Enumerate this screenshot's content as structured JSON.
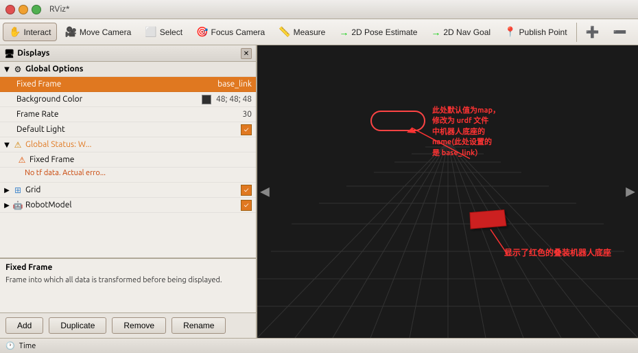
{
  "window": {
    "title": "RViz*"
  },
  "toolbar": {
    "interact_label": "Interact",
    "move_camera_label": "Move Camera",
    "select_label": "Select",
    "focus_camera_label": "Focus Camera",
    "measure_label": "Measure",
    "pose_estimate_label": "2D Pose Estimate",
    "nav_goal_label": "2D Nav Goal",
    "publish_point_label": "Publish Point"
  },
  "displays": {
    "title": "Displays",
    "global_options_label": "Global Options",
    "fixed_frame_label": "Fixed Frame",
    "fixed_frame_value": "base_link",
    "background_color_label": "Background Color",
    "background_color_value": "48; 48; 48",
    "frame_rate_label": "Frame Rate",
    "frame_rate_value": "30",
    "default_light_label": "Default Light",
    "global_status_label": "Global Status: W...",
    "fixed_frame_sub_label": "Fixed Frame",
    "fixed_frame_error": "No tf data.  Actual erro...",
    "grid_label": "Grid",
    "robot_model_label": "RobotModel"
  },
  "info_panel": {
    "title": "Fixed Frame",
    "description": "Frame into which all data is transformed before\nbeing displayed."
  },
  "buttons": {
    "add": "Add",
    "duplicate": "Duplicate",
    "remove": "Remove",
    "rename": "Rename"
  },
  "annotations": {
    "annotation1": "此处默认值为map，",
    "annotation2": "修改为 urdf 文件",
    "annotation3": "中机器人底座的",
    "annotation4": "name(此处设置的",
    "annotation5": "是 base_link）",
    "annotation6": "显示了红色的叠装机器人底座"
  },
  "statusbar": {
    "time_label": "Time"
  },
  "colors": {
    "accent_orange": "#e07820",
    "error_red": "#ff4444",
    "viewport_bg": "#1a1a1a",
    "grid_color": "#404040"
  }
}
